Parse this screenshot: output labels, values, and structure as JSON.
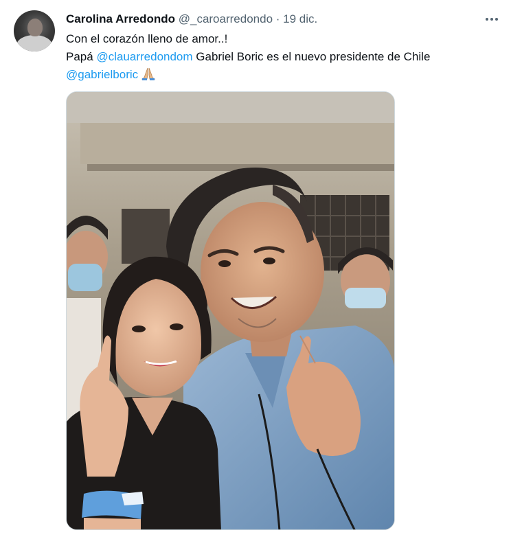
{
  "tweet": {
    "author_name": "Carolina Arredondo",
    "author_handle": "@_caroarredondo",
    "separator": "·",
    "date": "19 dic.",
    "text_line1": "Con el corazón lleno de amor..!",
    "text_line2_prefix": "Papá ",
    "mention1": "@clauarredondom",
    "text_line2_suffix": " Gabriel Boric es el nuevo presidente de Chile",
    "mention2": "@gabrielboric",
    "emoji": "folded-hands-emoji",
    "more_icon": "more-options-icon"
  },
  "media": {
    "description_icon": "photo",
    "colors": {
      "wall": "#a79d8c",
      "shirt": "#7ea0c4",
      "hair": "#2a2523"
    }
  },
  "colors": {
    "link": "#1d9bf0",
    "text": "#0f1419",
    "secondary": "#536471",
    "border": "#cfd9de"
  }
}
